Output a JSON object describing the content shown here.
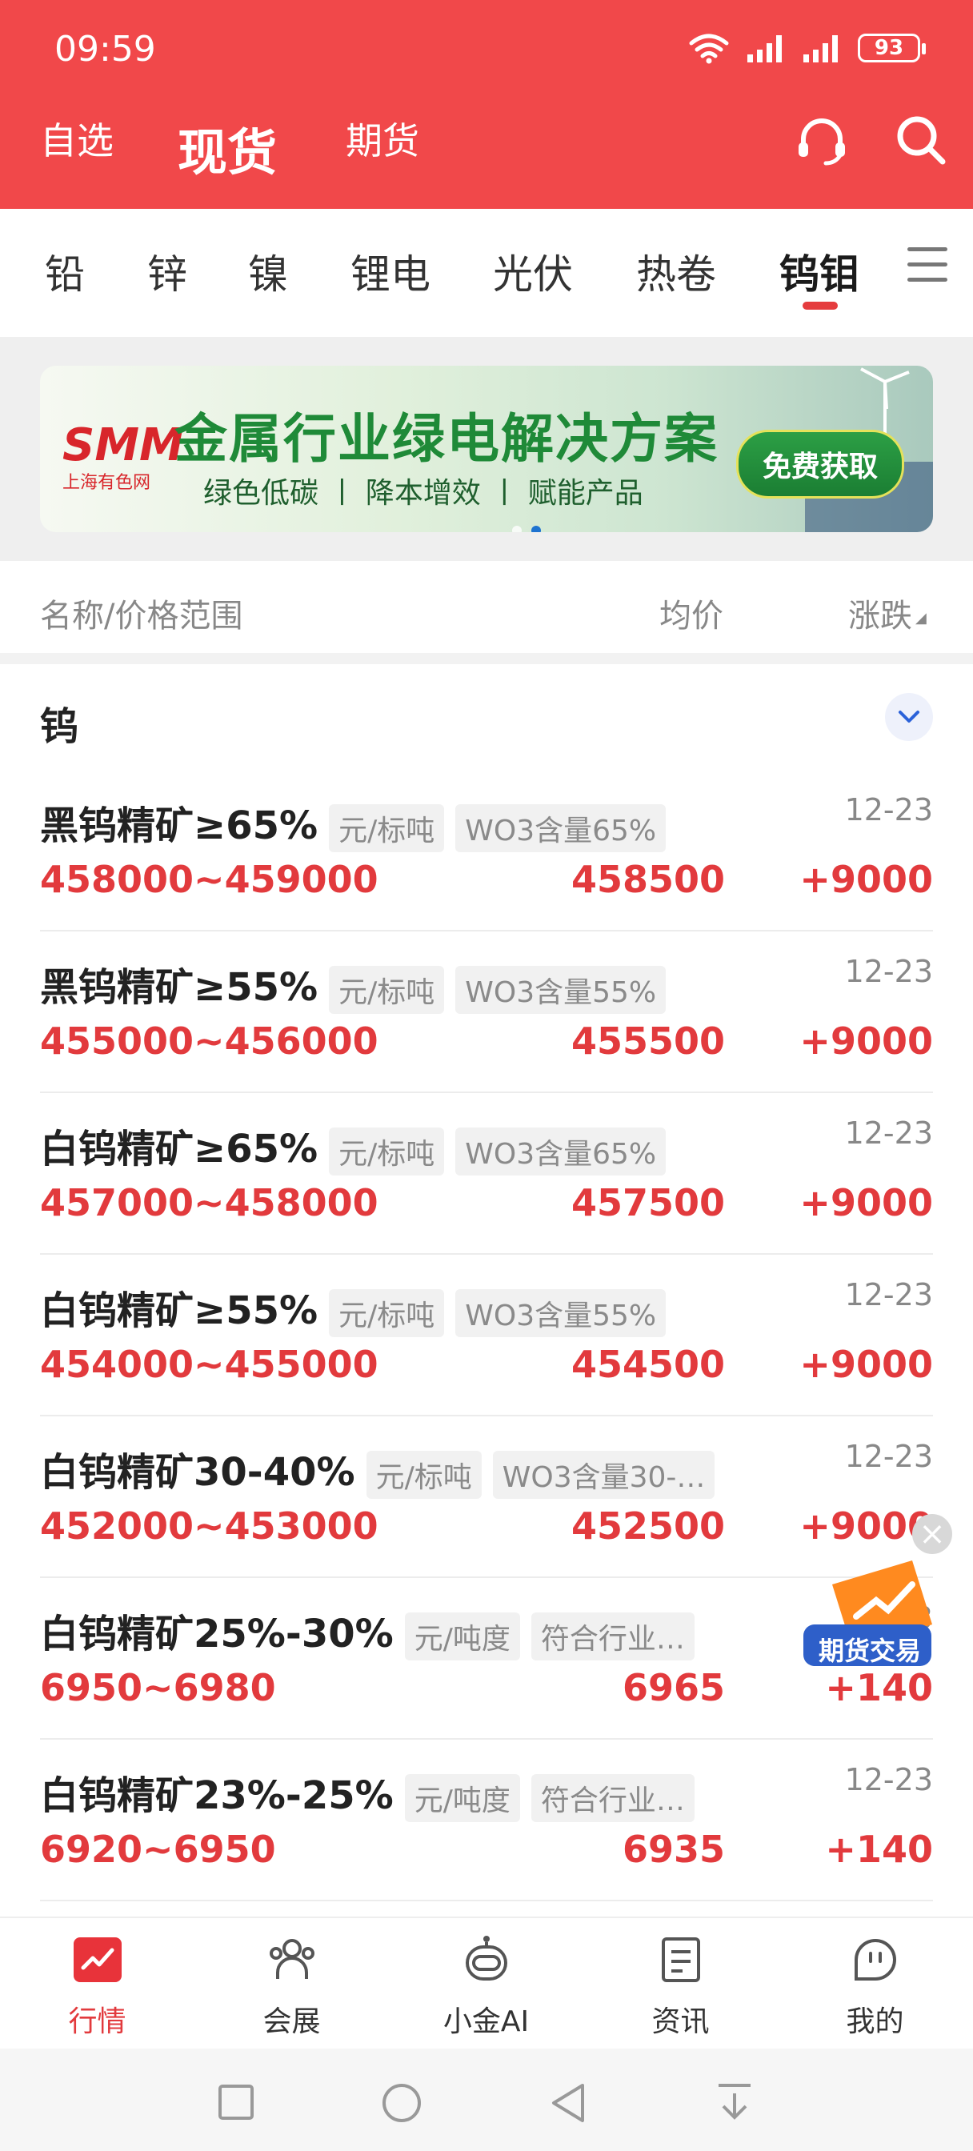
{
  "status_bar": {
    "time": "09:59",
    "battery": "93"
  },
  "header": {
    "tabs": [
      {
        "label": "自选"
      },
      {
        "label": "现货"
      },
      {
        "label": "期货"
      }
    ]
  },
  "categories": [
    {
      "label": "铅"
    },
    {
      "label": "锌"
    },
    {
      "label": "镍"
    },
    {
      "label": "锂电"
    },
    {
      "label": "光伏"
    },
    {
      "label": "热卷"
    },
    {
      "label": "钨钼"
    }
  ],
  "banner": {
    "logo": "SMM",
    "logo_cn": "上海有色网",
    "title": "金属行业绿电解决方案",
    "subtitle": "绿色低碳 丨 降本增效 丨 赋能产品",
    "button": "免费获取"
  },
  "columns": {
    "name": "名称/价格范围",
    "avg": "均价",
    "change": "涨跌"
  },
  "group": {
    "title": "钨"
  },
  "rows": [
    {
      "name": "黑钨精矿≥65%",
      "unit": "元/标吨",
      "spec": "WO3含量65%",
      "date": "12-23",
      "range": "458000~459000",
      "avg": "458500",
      "change": "+9000"
    },
    {
      "name": "黑钨精矿≥55%",
      "unit": "元/标吨",
      "spec": "WO3含量55%",
      "date": "12-23",
      "range": "455000~456000",
      "avg": "455500",
      "change": "+9000"
    },
    {
      "name": "白钨精矿≥65%",
      "unit": "元/标吨",
      "spec": "WO3含量65%",
      "date": "12-23",
      "range": "457000~458000",
      "avg": "457500",
      "change": "+9000"
    },
    {
      "name": "白钨精矿≥55%",
      "unit": "元/标吨",
      "spec": "WO3含量55%",
      "date": "12-23",
      "range": "454000~455000",
      "avg": "454500",
      "change": "+9000"
    },
    {
      "name": "白钨精矿30-40%",
      "unit": "元/标吨",
      "spec": "WO3含量30-…",
      "date": "12-23",
      "range": "452000~453000",
      "avg": "452500",
      "change": "+9000"
    },
    {
      "name": "白钨精矿25%-30%",
      "unit": "元/吨度",
      "spec": "符合行业…",
      "date": "12-23",
      "range": "6950~6980",
      "avg": "6965",
      "change": "+140"
    },
    {
      "name": "白钨精矿23%-25%",
      "unit": "元/吨度",
      "spec": "符合行业…",
      "date": "12-23",
      "range": "6920~6950",
      "avg": "6935",
      "change": "+140"
    }
  ],
  "float_ad": {
    "label": "期货交易"
  },
  "bottom_nav": [
    {
      "label": "行情"
    },
    {
      "label": "会展"
    },
    {
      "label": "小金AI"
    },
    {
      "label": "资讯"
    },
    {
      "label": "我的"
    }
  ],
  "colors": {
    "brand_red": "#f1484a",
    "price_red": "#e23a3d"
  }
}
